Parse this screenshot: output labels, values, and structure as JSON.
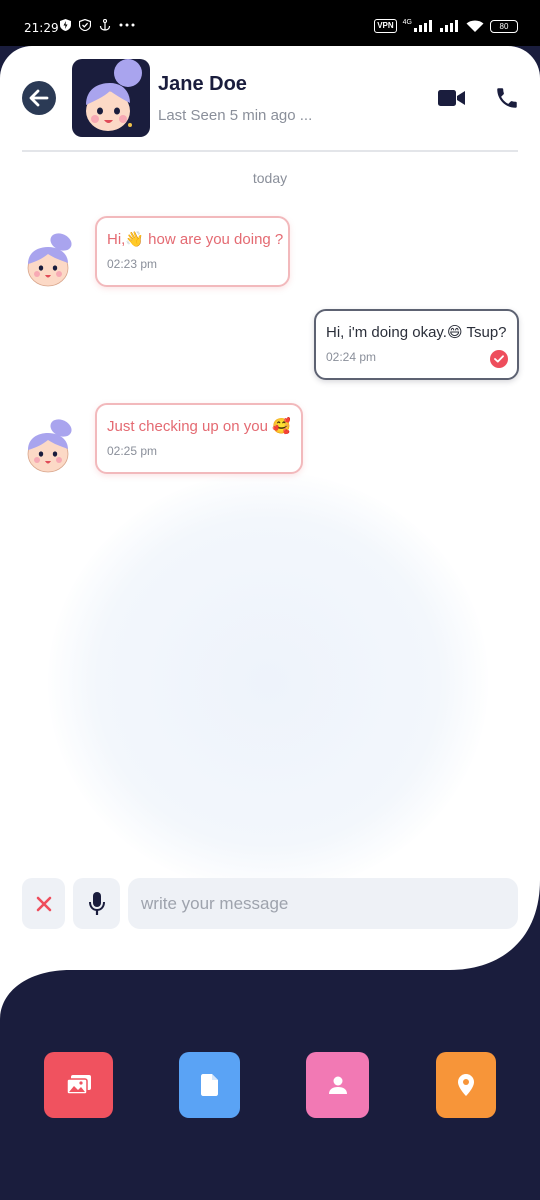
{
  "status_bar": {
    "time": "21:29",
    "vpn_label": "VPN",
    "network_label": "4G",
    "battery": "80"
  },
  "header": {
    "contact_name": "Jane Doe",
    "last_seen": "Last Seen 5 min ago ...",
    "icons": [
      "back-arrow-icon",
      "video-camera-icon",
      "phone-icon"
    ]
  },
  "chat": {
    "day_label": "today",
    "messages": [
      {
        "direction": "incoming",
        "text": "Hi,👋 how are you doing ?",
        "time": "02:23 pm"
      },
      {
        "direction": "outgoing",
        "text": "Hi, i'm doing okay.😄 Tsup?",
        "time": "02:24 pm",
        "status": "read-check-icon"
      },
      {
        "direction": "incoming",
        "text": "Just checking up on you 🥰",
        "time": "02:25 pm"
      }
    ]
  },
  "composer": {
    "placeholder": "write your message",
    "value": "",
    "icons": [
      "close-icon",
      "microphone-icon"
    ]
  },
  "attachments": [
    {
      "name": "gallery",
      "icon": "image-gallery-icon",
      "color": "#f0525f"
    },
    {
      "name": "document",
      "icon": "document-icon",
      "color": "#5aa3f5"
    },
    {
      "name": "contact",
      "icon": "contact-person-icon",
      "color": "#f279b4"
    },
    {
      "name": "location",
      "icon": "location-pin-icon",
      "color": "#f79539"
    }
  ],
  "colors": {
    "navy": "#1a1d3d",
    "incoming_text": "#e46a72",
    "incoming_border": "#f2b9bc",
    "accent_red": "#ee4d5c"
  }
}
